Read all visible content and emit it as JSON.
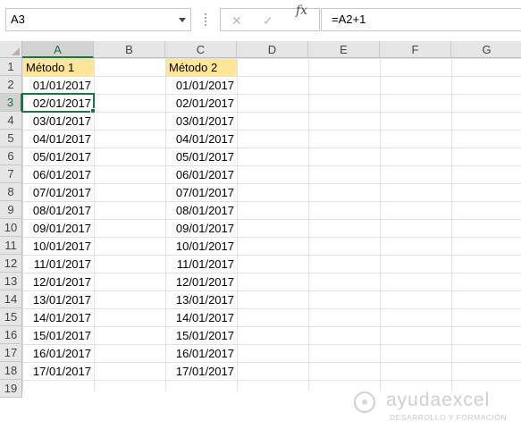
{
  "formula_bar": {
    "name_box": "A3",
    "formula": "=A2+1",
    "fx_label": "fx",
    "cancel_icon": "✕",
    "enter_icon": "✓"
  },
  "columns": [
    "A",
    "B",
    "C",
    "D",
    "E",
    "F",
    "G"
  ],
  "selected_column": "A",
  "selected_row": "3",
  "rows": [
    "1",
    "2",
    "3",
    "4",
    "5",
    "6",
    "7",
    "8",
    "9",
    "10",
    "11",
    "12",
    "13",
    "14",
    "15",
    "16",
    "17",
    "18",
    "19"
  ],
  "colors": {
    "accent": "#217346",
    "header_fill": "#FFE699"
  },
  "sheet": {
    "column_a": {
      "header": "Método 1",
      "values": [
        "01/01/2017",
        "02/01/2017",
        "03/01/2017",
        "04/01/2017",
        "05/01/2017",
        "06/01/2017",
        "07/01/2017",
        "08/01/2017",
        "09/01/2017",
        "10/01/2017",
        "11/01/2017",
        "12/01/2017",
        "13/01/2017",
        "14/01/2017",
        "15/01/2017",
        "16/01/2017",
        "17/01/2017"
      ]
    },
    "column_c": {
      "header": "Método 2",
      "values": [
        "01/01/2017",
        "02/01/2017",
        "03/01/2017",
        "04/01/2017",
        "05/01/2017",
        "06/01/2017",
        "07/01/2017",
        "08/01/2017",
        "09/01/2017",
        "10/01/2017",
        "11/01/2017",
        "12/01/2017",
        "13/01/2017",
        "14/01/2017",
        "15/01/2017",
        "16/01/2017",
        "17/01/2017"
      ]
    }
  },
  "watermark": {
    "brand": "ayudaexcel",
    "tagline": "DESARROLLO Y FORMACIÓN"
  }
}
